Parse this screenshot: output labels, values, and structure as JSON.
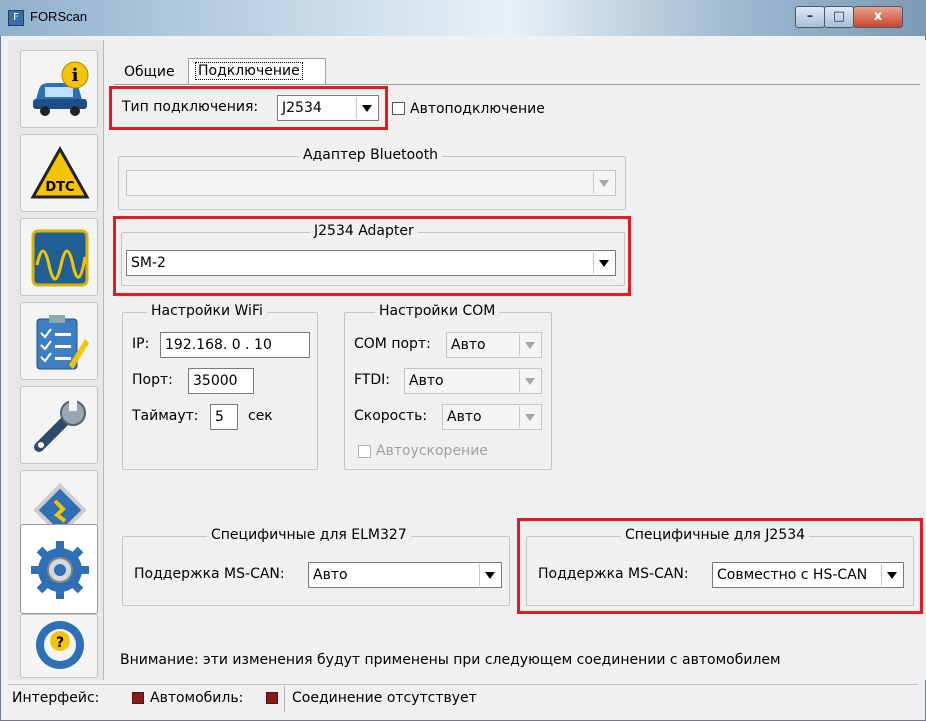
{
  "window": {
    "title": "FORScan",
    "minimize": "–",
    "maximize": "□",
    "close": "x"
  },
  "sidebar": {
    "items": [
      {
        "name": "vehicle-info",
        "icon": "car-info-icon",
        "active": false
      },
      {
        "name": "dtc",
        "icon": "dtc-warning-icon",
        "badge": "DTC",
        "active": false
      },
      {
        "name": "oscilloscope",
        "icon": "oscilloscope-icon",
        "active": false
      },
      {
        "name": "checklist",
        "icon": "checklist-icon",
        "active": false
      },
      {
        "name": "service",
        "icon": "wrench-icon",
        "active": false
      },
      {
        "name": "configuration",
        "icon": "chip-icon",
        "active": false
      },
      {
        "name": "settings",
        "icon": "gear-icon",
        "active": true
      },
      {
        "name": "help",
        "icon": "help-wheel-icon",
        "active": false
      }
    ]
  },
  "tabs": {
    "general": "Общие",
    "connection": "Подключение"
  },
  "connection": {
    "type_label": "Тип подключения:",
    "type_value": "J2534",
    "autoconnect_label": "Автоподключение",
    "autoconnect_checked": false
  },
  "bluetooth": {
    "title": "Адаптер Bluetooth",
    "value": ""
  },
  "j2534_adapter": {
    "title": "J2534 Adapter",
    "value": "SM-2"
  },
  "wifi": {
    "title": "Настройки WiFi",
    "ip_label": "IP:",
    "ip_value": "192.168. 0 . 10",
    "port_label": "Порт:",
    "port_value": "35000",
    "timeout_label": "Таймаут:",
    "timeout_value": "5",
    "timeout_unit": "сек"
  },
  "com": {
    "title": "Настройки COM",
    "port_label": "COM порт:",
    "port_value": "Авто",
    "ftdi_label": "FTDI:",
    "ftdi_value": "Авто",
    "speed_label": "Скорость:",
    "speed_value": "Авто",
    "autospeed_label": "Автоускорение",
    "autospeed_checked": false
  },
  "elm327": {
    "title": "Специфичные для ELM327",
    "mscan_label": "Поддержка MS-CAN:",
    "mscan_value": "Авто"
  },
  "j2534_specific": {
    "title": "Специфичные для J2534",
    "mscan_label": "Поддержка MS-CAN:",
    "mscan_value": "Совместно с HS-CAN"
  },
  "notice": "Внимание: эти изменения будут применены при следующем соединении с автомобилем",
  "status": {
    "interface_label": "Интерфейс:",
    "vehicle_label": "Автомобиль:",
    "connection_text": "Соединение отсутствует",
    "indicator_color": "#8b1a1a"
  },
  "colors": {
    "highlight": "#e31b23"
  }
}
